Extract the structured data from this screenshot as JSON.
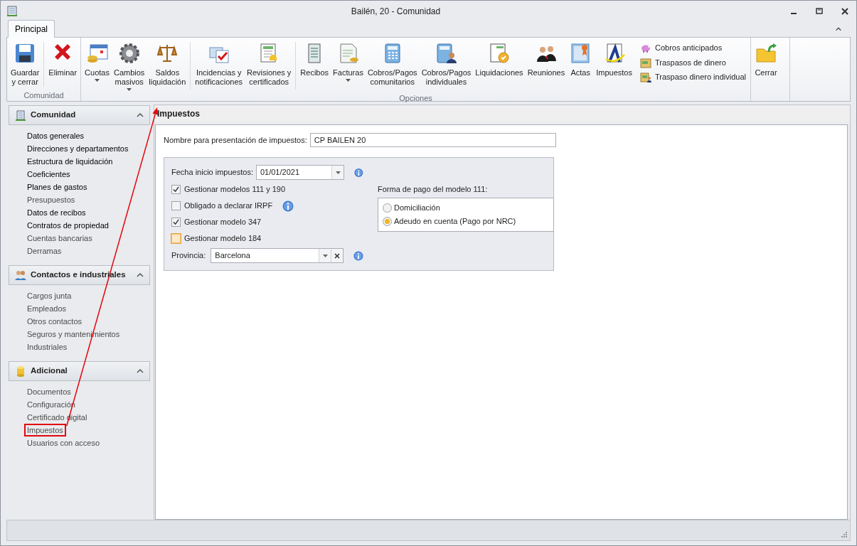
{
  "window": {
    "title": "Bailén, 20 - Comunidad"
  },
  "ribbon": {
    "tabs": [
      {
        "label": "Principal",
        "selected": true
      }
    ],
    "groups": [
      {
        "label": "Comunidad",
        "items": [
          {
            "kind": "large",
            "label": "Guardar\ny cerrar"
          },
          {
            "kind": "separator"
          },
          {
            "kind": "large",
            "label": "Eliminar"
          }
        ]
      },
      {
        "label": "Opciones",
        "items": [
          {
            "kind": "large",
            "label": "Cuotas",
            "dropdown": true
          },
          {
            "kind": "large",
            "label": "Cambios\nmasivos",
            "dropdown": true
          },
          {
            "kind": "large",
            "label": "Saldos\nliquidación"
          },
          {
            "kind": "separator"
          },
          {
            "kind": "large",
            "label": "Incidencias y\nnotificaciones"
          },
          {
            "kind": "large",
            "label": "Revisiones y\ncertificados"
          },
          {
            "kind": "separator"
          },
          {
            "kind": "large",
            "label": "Recibos"
          },
          {
            "kind": "large",
            "label": "Facturas",
            "dropdown": true
          },
          {
            "kind": "large",
            "label": "Cobros/Pagos\ncomunitarios"
          },
          {
            "kind": "large",
            "label": "Cobros/Pagos\nindividuales"
          },
          {
            "kind": "large",
            "label": "Liquidaciones"
          },
          {
            "kind": "large",
            "label": "Reuniones"
          },
          {
            "kind": "large",
            "label": "Actas"
          },
          {
            "kind": "large",
            "label": "Impuestos"
          },
          {
            "kind": "stack",
            "items": [
              {
                "label": "Cobros anticipados"
              },
              {
                "label": "Traspasos de dinero"
              },
              {
                "label": "Traspaso dinero individual"
              }
            ]
          }
        ]
      },
      {
        "items": [
          {
            "kind": "large",
            "label": "Cerrar"
          }
        ]
      }
    ]
  },
  "sidebar": {
    "sections": [
      {
        "title": "Comunidad",
        "expanded": true,
        "items": [
          {
            "label": "Datos generales",
            "dimmed": false,
            "highlighted": false
          },
          {
            "label": "Direcciones y departamentos",
            "dimmed": false,
            "highlighted": false
          },
          {
            "label": "Estructura de liquidación",
            "dimmed": false,
            "highlighted": false
          },
          {
            "label": "Coeficientes",
            "dimmed": false,
            "highlighted": false
          },
          {
            "label": "Planes de gastos",
            "dimmed": false,
            "highlighted": false
          },
          {
            "label": "Presupuestos",
            "dimmed": true,
            "highlighted": false
          },
          {
            "label": "Datos de recibos",
            "dimmed": false,
            "highlighted": false
          },
          {
            "label": "Contratos de propiedad",
            "dimmed": false,
            "highlighted": false
          },
          {
            "label": "Cuentas bancarias",
            "dimmed": true,
            "highlighted": false
          },
          {
            "label": "Derramas",
            "dimmed": true,
            "highlighted": false
          }
        ]
      },
      {
        "title": "Contactos e industriales",
        "expanded": true,
        "items": [
          {
            "label": "Cargos junta",
            "dimmed": true,
            "highlighted": false
          },
          {
            "label": "Empleados",
            "dimmed": true,
            "highlighted": false
          },
          {
            "label": "Otros contactos",
            "dimmed": true,
            "highlighted": false
          },
          {
            "label": "Seguros y mantenimientos",
            "dimmed": true,
            "highlighted": false
          },
          {
            "label": "Industriales",
            "dimmed": true,
            "highlighted": false
          }
        ]
      },
      {
        "title": "Adicional",
        "expanded": true,
        "items": [
          {
            "label": "Documentos",
            "dimmed": true,
            "highlighted": false
          },
          {
            "label": "Configuración",
            "dimmed": true,
            "highlighted": false
          },
          {
            "label": "Certificado digital",
            "dimmed": true,
            "highlighted": false
          },
          {
            "label": "Impuestos",
            "dimmed": true,
            "highlighted": true
          },
          {
            "label": "Usuarios con acceso",
            "dimmed": true,
            "highlighted": false
          }
        ]
      }
    ]
  },
  "panel": {
    "title": "Impuestos",
    "name_field": {
      "label": "Nombre para presentación de impuestos:",
      "value": "CP BAILEN 20"
    },
    "date_field": {
      "label": "Fecha inicio impuestos:",
      "value": "01/01/2021",
      "info": true
    },
    "checkboxes": [
      {
        "label": "Gestionar modelos 111 y 190",
        "checked": true
      },
      {
        "label": "Obligado a declarar IRPF",
        "checked": false,
        "focused": false,
        "info": true
      },
      {
        "label": "Gestionar modelo 347",
        "checked": true
      },
      {
        "label": "Gestionar modelo 184",
        "checked": false,
        "focused": true
      }
    ],
    "payment": {
      "label": "Forma de pago del modelo 111:",
      "options": [
        {
          "label": "Domiciliación",
          "selected": false
        },
        {
          "label": "Adeudo en cuenta (Pago por NRC)",
          "selected": true
        }
      ]
    },
    "province_field": {
      "label": "Provincia:",
      "value": "Barcelona",
      "info": true
    }
  }
}
